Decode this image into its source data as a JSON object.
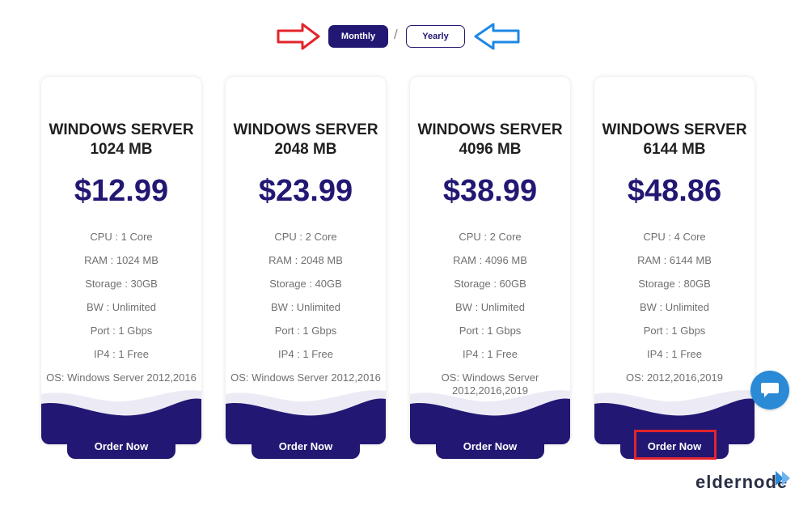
{
  "billing_toggle": {
    "monthly_label": "Monthly",
    "separator": "/",
    "yearly_label": "Yearly",
    "selected": "Monthly"
  },
  "plans": [
    {
      "title_line1": "WINDOWS SERVER",
      "title_line2": "1024 MB",
      "price": "$12.99",
      "features": [
        "CPU : 1 Core",
        "RAM : 1024 MB",
        "Storage : 30GB",
        "BW : Unlimited",
        "Port : 1 Gbps",
        "IP4 : 1 Free",
        "OS: Windows Server 2012,2016"
      ],
      "order_label": "Order Now"
    },
    {
      "title_line1": "WINDOWS SERVER",
      "title_line2": "2048 MB",
      "price": "$23.99",
      "features": [
        "CPU : 2 Core",
        "RAM : 2048 MB",
        "Storage : 40GB",
        "BW : Unlimited",
        "Port : 1 Gbps",
        "IP4 : 1 Free",
        "OS: Windows Server 2012,2016"
      ],
      "order_label": "Order Now"
    },
    {
      "title_line1": "WINDOWS SERVER",
      "title_line2": "4096 MB",
      "price": "$38.99",
      "features": [
        "CPU : 2 Core",
        "RAM : 4096 MB",
        "Storage : 60GB",
        "BW : Unlimited",
        "Port : 1 Gbps",
        "IP4 : 1 Free",
        "OS: Windows Server 2012,2016,2019"
      ],
      "order_label": "Order Now"
    },
    {
      "title_line1": "WINDOWS SERVER",
      "title_line2": "6144 MB",
      "price": "$48.86",
      "features": [
        "CPU : 4 Core",
        "RAM : 6144 MB",
        "Storage : 80GB",
        "BW : Unlimited",
        "Port : 1 Gbps",
        "IP4 : 1 Free",
        "OS: 2012,2016,2019"
      ],
      "order_label": "Order Now"
    }
  ],
  "brand": {
    "logo_text": "eldernode"
  },
  "colors": {
    "primary": "#221873",
    "annotation_red": "#e3242b",
    "annotation_blue": "#1e88e5",
    "chat": "#2b8ad6"
  },
  "icons": {
    "left_annotation": "arrow-right-icon",
    "right_annotation": "arrow-left-icon",
    "chat": "chat-icon"
  }
}
